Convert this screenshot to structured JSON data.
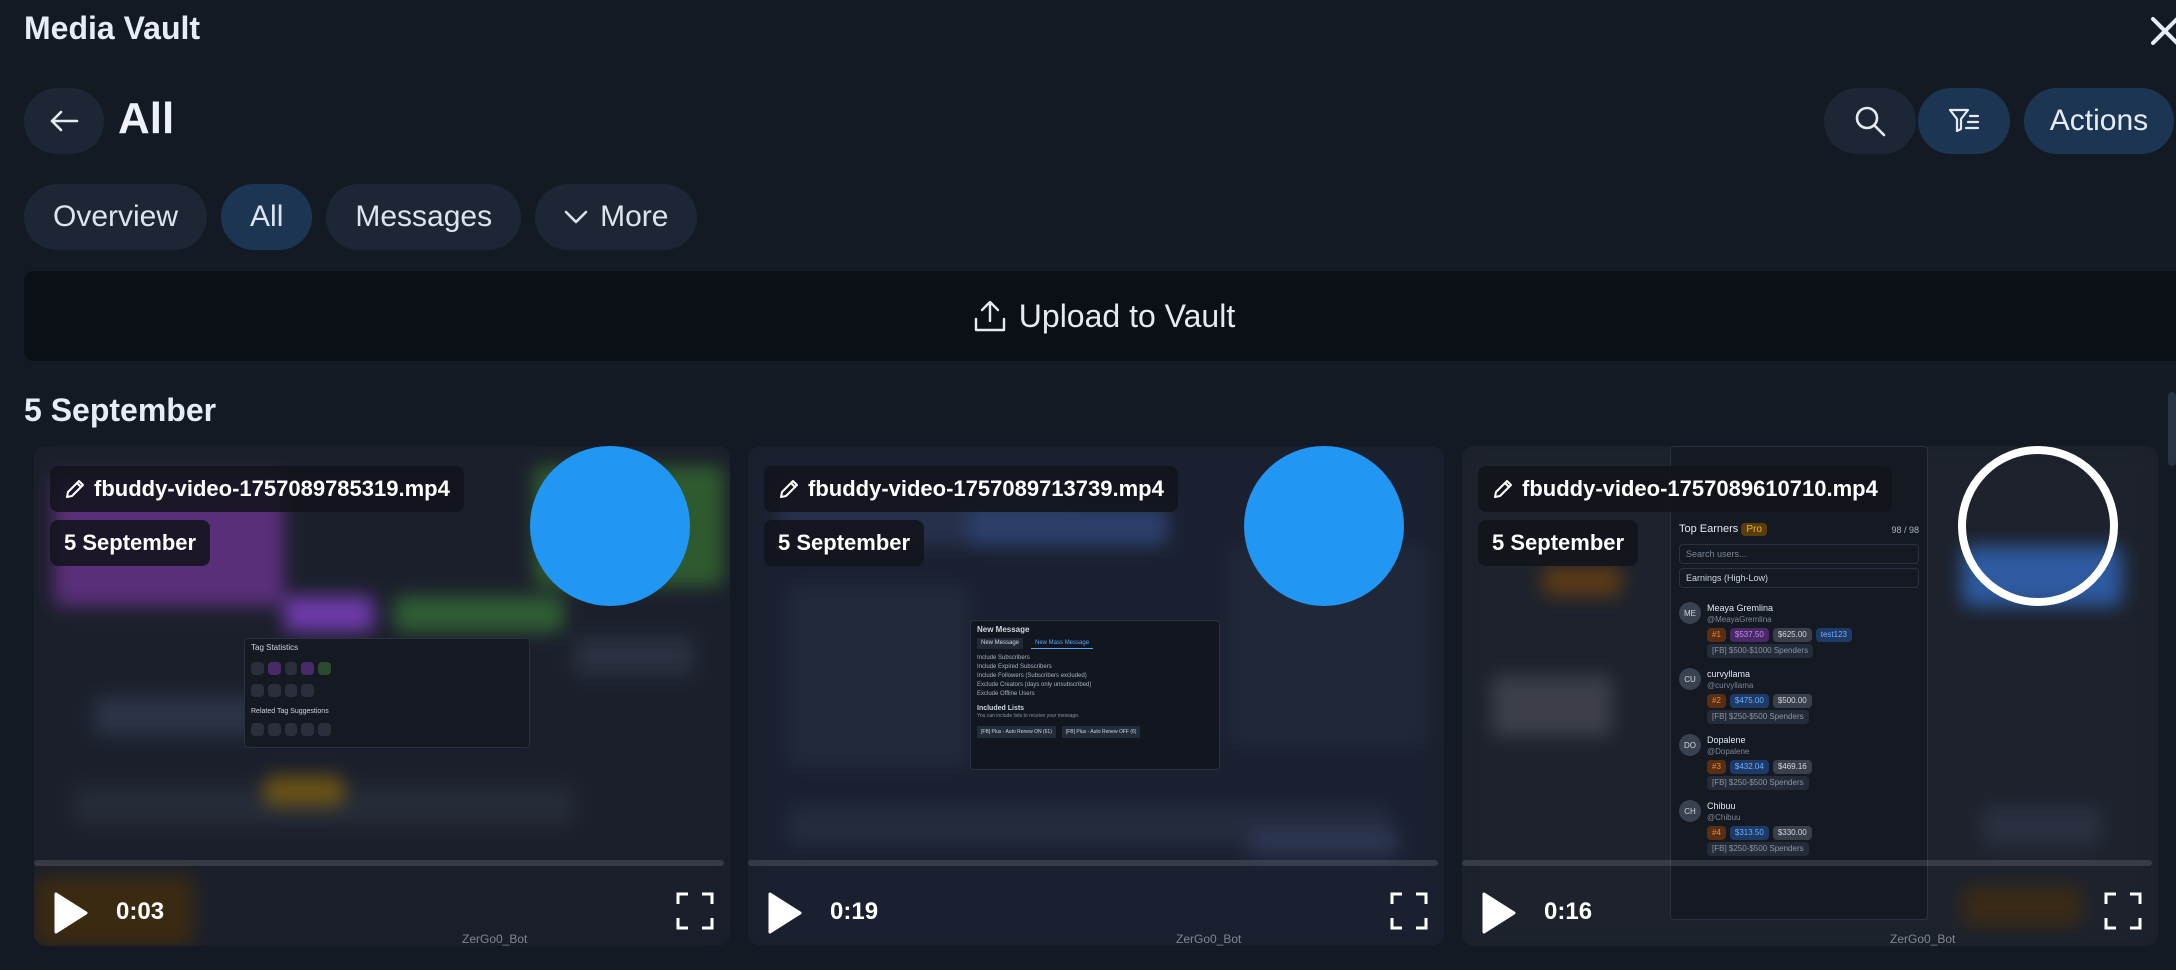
{
  "app": {
    "title": "Media Vault"
  },
  "header": {
    "heading": "All",
    "actions_label": "Actions"
  },
  "tabs": [
    {
      "label": "Overview",
      "active": false
    },
    {
      "label": "All",
      "active": true
    },
    {
      "label": "Messages",
      "active": false
    },
    {
      "label": "More",
      "active": false
    }
  ],
  "upload": {
    "label": "Upload to Vault"
  },
  "section": {
    "date_heading": "5 September"
  },
  "cards": [
    {
      "filename": "fbuddy-video-1757089785319.mp4",
      "date": "5 September",
      "duration": "0:03",
      "watermark": "ZerGo0_Bot",
      "selected": true,
      "preview": {
        "panel_title": "Tag Statistics",
        "panel_subtitle": "Related Tag Suggestions"
      }
    },
    {
      "filename": "fbuddy-video-1757089713739.mp4",
      "date": "5 September",
      "duration": "0:19",
      "watermark": "ZerGo0_Bot",
      "selected": true,
      "preview": {
        "panel_title": "New Message",
        "tab_a": "New Message",
        "tab_b": "New Mass Message",
        "options": [
          "Include Subscribers",
          "Include Expired Subscribers",
          "Include Followers (Subscribers excluded)",
          "Exclude Creators (days only unsubscribed)",
          "Exclude Offline Users"
        ],
        "lists_title": "Included Lists",
        "lists_hint": "You can include lists to receive your message.",
        "list_chip_1": "[FB] Plus - Auto Renew ON (61)",
        "list_chip_2": "[FB] Plus - Auto Renew OFF (6)"
      }
    },
    {
      "filename": "fbuddy-video-1757089610710.mp4",
      "date": "5 September",
      "duration": "0:16",
      "watermark": "ZerGo0_Bot",
      "selected": false,
      "preview": {
        "panel_title": "Top Earners",
        "pro_label": "Pro",
        "count": "98 / 98",
        "search_placeholder": "Search users...",
        "sort_label": "Earnings (High-Low)",
        "users": [
          {
            "initials": "ME",
            "name": "Meaya Gremlina",
            "handle": "@MeayaGremlina",
            "rank": "#1",
            "earn": "$537.50",
            "sub": "$625.00",
            "extra": "test123",
            "segment": "[FB] $500-$1000 Spenders"
          },
          {
            "initials": "CU",
            "name": "curvyllama",
            "handle": "@curvyllama",
            "rank": "#2",
            "earn": "$475.00",
            "sub": "$500.00",
            "extra": "",
            "segment": "[FB] $250-$500 Spenders"
          },
          {
            "initials": "DO",
            "name": "Dopalene",
            "handle": "@Dopalene",
            "rank": "#3",
            "earn": "$432.04",
            "sub": "$469.16",
            "extra": "",
            "segment": "[FB] $250-$500 Spenders"
          },
          {
            "initials": "CH",
            "name": "Chibuu",
            "handle": "@Chibuu",
            "rank": "#4",
            "earn": "$313.50",
            "sub": "$330.00",
            "extra": "",
            "segment": "[FB] $250-$500 Spenders"
          }
        ]
      }
    }
  ],
  "colors": {
    "background": "#131a24",
    "pill": "#1d2634",
    "pill_active": "#1c3553",
    "select_accent": "#2196f3"
  }
}
